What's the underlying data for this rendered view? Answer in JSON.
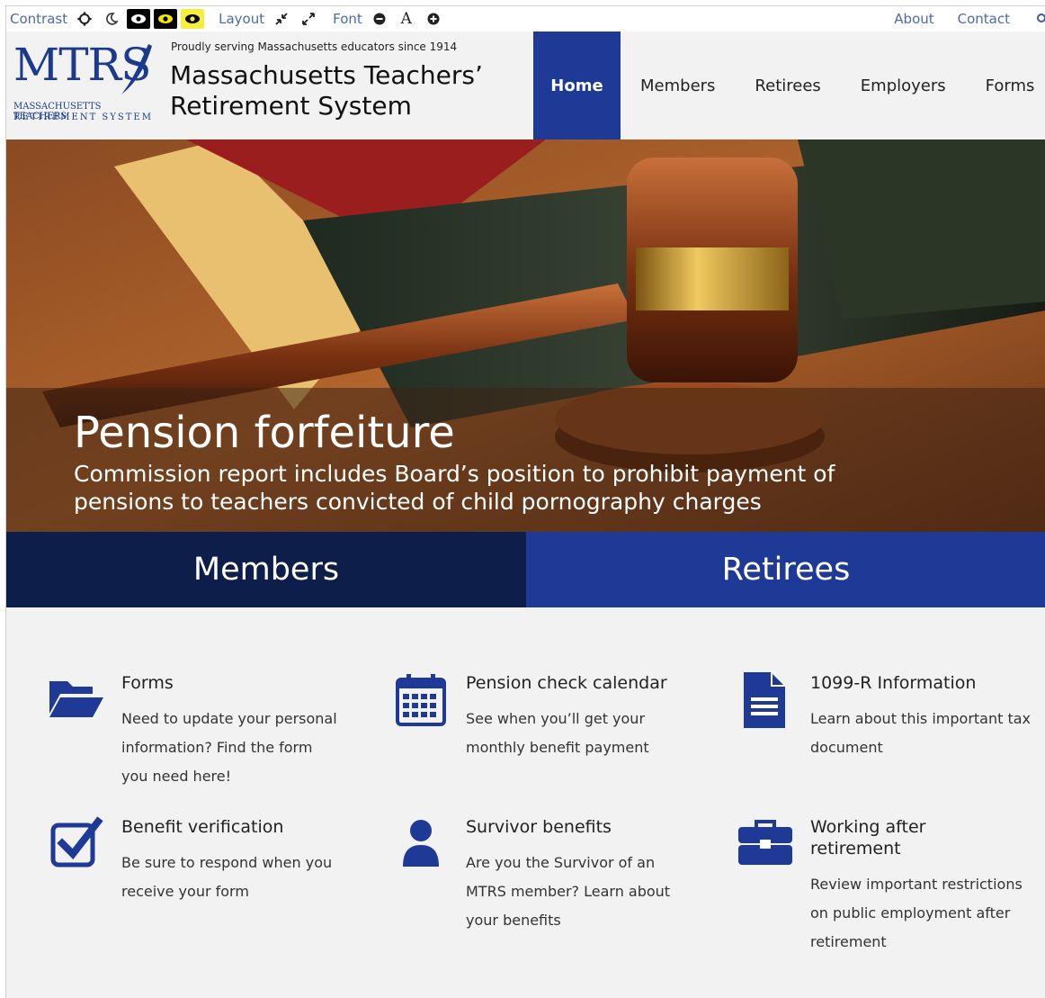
{
  "toolbar": {
    "contrast_label": "Contrast",
    "layout_label": "Layout",
    "font_label": "Font",
    "font_letter": "A",
    "about": "About",
    "contact": "Contact"
  },
  "header": {
    "logo_text": "MTRS",
    "logo_sub1": "MASSACHUSETTS TEACHERS'",
    "logo_sub2": "RETIREMENT SYSTEM",
    "tagline": "Proudly serving Massachusetts educators since 1914",
    "site_name": "Massachusetts Teachers’ Retirement System"
  },
  "nav": {
    "items": [
      "Home",
      "Members",
      "Retirees",
      "Employers",
      "Forms"
    ]
  },
  "hero": {
    "title": "Pension forfeiture",
    "subtitle": "Commission report includes Board’s position to prohibit payment of pensions to teachers convicted of child pornography charges"
  },
  "big_buttons": {
    "members": "Members",
    "retirees": "Retirees"
  },
  "cards": {
    "forms": {
      "title": "Forms",
      "desc": "Need to update your personal information? Find the form you need here!",
      "icon": "folder-open-icon"
    },
    "calendar": {
      "title": "Pension check calendar",
      "desc": "See when you’ll get your monthly benefit payment",
      "icon": "calendar-icon"
    },
    "tax": {
      "title": "1099-R Information",
      "desc": "Learn about this important tax document",
      "icon": "document-icon"
    },
    "verification": {
      "title": "Benefit verification",
      "desc": "Be sure to respond when you receive your form",
      "icon": "checkbox-icon"
    },
    "survivor": {
      "title": "Survivor benefits",
      "desc": "Are you the Survivor of an MTRS member? Learn about your benefits",
      "icon": "person-icon"
    },
    "working": {
      "title": "Working after retirement",
      "desc": "Review important restrictions on public employment after retirement",
      "icon": "briefcase-icon"
    }
  },
  "colors": {
    "primary_blue": "#1e3a96",
    "navy": "#0e1e4a",
    "page_bg": "#f2f2f2"
  }
}
